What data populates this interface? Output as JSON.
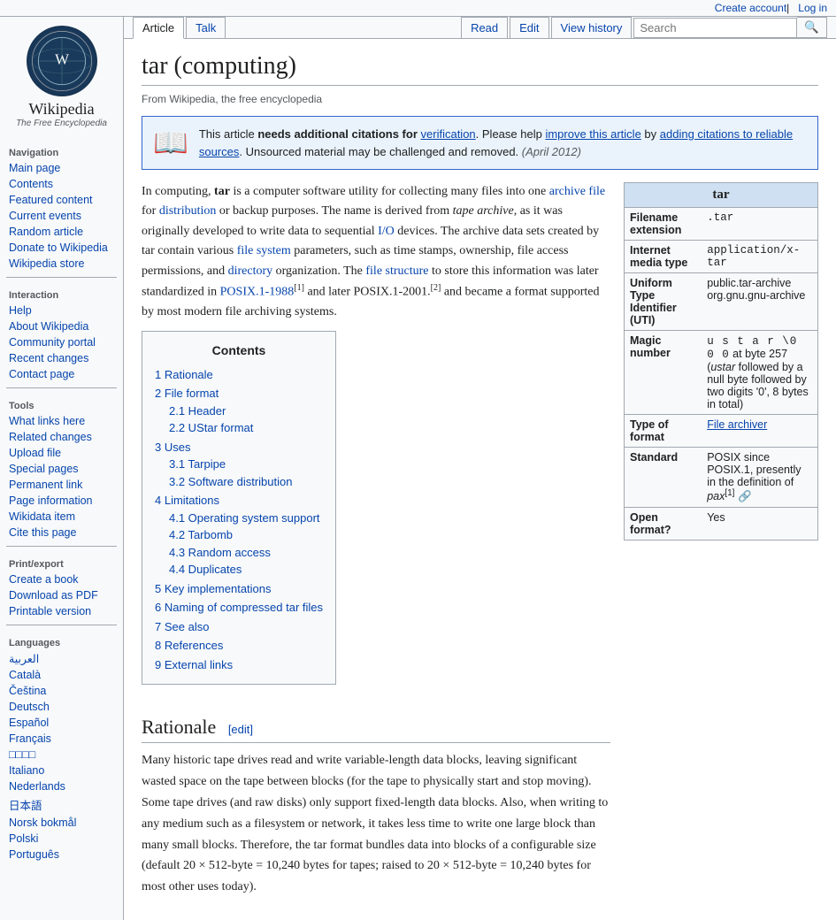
{
  "topbar": {
    "create_account": "Create account",
    "log_in": "Log in"
  },
  "logo": {
    "title": "Wikipedia",
    "subtitle": "The Free Encyclopedia"
  },
  "sidebar": {
    "navigation_label": "Navigation",
    "navigation_items": [
      {
        "label": "Main page",
        "key": "main-page"
      },
      {
        "label": "Contents",
        "key": "contents"
      },
      {
        "label": "Featured content",
        "key": "featured-content"
      },
      {
        "label": "Current events",
        "key": "current-events"
      },
      {
        "label": "Random article",
        "key": "random-article"
      },
      {
        "label": "Donate to Wikipedia",
        "key": "donate"
      },
      {
        "label": "Wikipedia store",
        "key": "store"
      }
    ],
    "interaction_label": "Interaction",
    "interaction_items": [
      {
        "label": "Help",
        "key": "help"
      },
      {
        "label": "About Wikipedia",
        "key": "about"
      },
      {
        "label": "Community portal",
        "key": "community-portal"
      },
      {
        "label": "Recent changes",
        "key": "recent-changes"
      },
      {
        "label": "Contact page",
        "key": "contact"
      }
    ],
    "tools_label": "Tools",
    "tools_items": [
      {
        "label": "What links here",
        "key": "what-links"
      },
      {
        "label": "Related changes",
        "key": "related-changes"
      },
      {
        "label": "Upload file",
        "key": "upload"
      },
      {
        "label": "Special pages",
        "key": "special"
      },
      {
        "label": "Permanent link",
        "key": "permanent"
      },
      {
        "label": "Page information",
        "key": "page-info"
      },
      {
        "label": "Wikidata item",
        "key": "wikidata"
      },
      {
        "label": "Cite this page",
        "key": "cite"
      }
    ],
    "print_label": "Print/export",
    "print_items": [
      {
        "label": "Create a book",
        "key": "create-book"
      },
      {
        "label": "Download as PDF",
        "key": "pdf"
      },
      {
        "label": "Printable version",
        "key": "printable"
      }
    ],
    "languages_label": "Languages",
    "language_items": [
      {
        "label": "العربية",
        "key": "arabic"
      },
      {
        "label": "Català",
        "key": "catala"
      },
      {
        "label": "Čeština",
        "key": "cestina"
      },
      {
        "label": "Deutsch",
        "key": "deutsch"
      },
      {
        "label": "Español",
        "key": "espanol"
      },
      {
        "label": "Français",
        "key": "francais"
      },
      {
        "label": "□□□□",
        "key": "lang4"
      },
      {
        "label": "Italiano",
        "key": "italiano"
      },
      {
        "label": "Nederlands",
        "key": "nederlands"
      },
      {
        "label": "日本語",
        "key": "japanese"
      },
      {
        "label": "Norsk bokmål",
        "key": "norsk"
      },
      {
        "label": "Polski",
        "key": "polski"
      },
      {
        "label": "Português",
        "key": "portugues"
      }
    ]
  },
  "tabs": {
    "article": "Article",
    "talk": "Talk",
    "read": "Read",
    "edit": "Edit",
    "view_history": "View history"
  },
  "search": {
    "placeholder": "Search",
    "value": ""
  },
  "page": {
    "title": "tar (computing)",
    "from_wiki": "From Wikipedia, the free encyclopedia"
  },
  "notice": {
    "icon": "📖",
    "text_before_bold": "This article ",
    "bold": "needs additional citations for",
    "link_verify": "verification",
    "text_after": ". Please help",
    "link_improve": "improve this article",
    "text_middle": "by",
    "link_adding": "adding citations to reliable sources",
    "text_end": ". Unsourced material may be challenged and removed.",
    "date": "(April 2012)"
  },
  "infobox": {
    "title": "tar",
    "rows": [
      {
        "label": "Filename extension",
        "value": ".tar",
        "mono": true
      },
      {
        "label": "Internet media type",
        "value": "application/x-tar",
        "mono": true
      },
      {
        "label": "Uniform Type Identifier (UTI)",
        "value": "public.tar-archive org.gnu.gnu-archive",
        "mono": false
      },
      {
        "label": "Magic number",
        "value": "u s t a r \\0 0 0 at byte 257 (ustar followed by a null byte followed by two digits '0', 8 bytes in total)",
        "mono": false
      },
      {
        "label": "Type of format",
        "value": "File archiver",
        "link": true,
        "mono": false
      },
      {
        "label": "Standard",
        "value": "POSIX since POSIX.1, presently in the definition of pax[1]",
        "mono": false
      },
      {
        "label": "Open format?",
        "value": "Yes",
        "mono": false
      }
    ]
  },
  "intro_text": "In computing, tar is a computer software utility for collecting many files into one archive file for distribution or backup purposes. The name is derived from tape archive, as it was originally developed to write data to sequential I/O devices. The archive data sets created by tar contain various file system parameters, such as time stamps, ownership, file access permissions, and directory organization. The file structure to store this information was later standardized in POSIX.1-1988[1] and later POSIX.1-2001.[2] and became a format supported by most modern file archiving systems.",
  "toc": {
    "title": "Contents",
    "items": [
      {
        "num": "1",
        "label": "Rationale",
        "anchor": "Rationale"
      },
      {
        "num": "2",
        "label": "File format",
        "anchor": "File_format",
        "children": [
          {
            "num": "2.1",
            "label": "Header",
            "anchor": "Header"
          },
          {
            "num": "2.2",
            "label": "UStar format",
            "anchor": "UStar_format"
          }
        ]
      },
      {
        "num": "3",
        "label": "Uses",
        "anchor": "Uses",
        "children": [
          {
            "num": "3.1",
            "label": "Tarpipe",
            "anchor": "Tarpipe"
          },
          {
            "num": "3.2",
            "label": "Software distribution",
            "anchor": "Software_distribution"
          }
        ]
      },
      {
        "num": "4",
        "label": "Limitations",
        "anchor": "Limitations",
        "children": [
          {
            "num": "4.1",
            "label": "Operating system support",
            "anchor": "OS_support"
          },
          {
            "num": "4.2",
            "label": "Tarbomb",
            "anchor": "Tarbomb"
          },
          {
            "num": "4.3",
            "label": "Random access",
            "anchor": "Random_access"
          },
          {
            "num": "4.4",
            "label": "Duplicates",
            "anchor": "Duplicates"
          }
        ]
      },
      {
        "num": "5",
        "label": "Key implementations",
        "anchor": "Key_implementations"
      },
      {
        "num": "6",
        "label": "Naming of compressed tar files",
        "anchor": "Naming"
      },
      {
        "num": "7",
        "label": "See also",
        "anchor": "See_also"
      },
      {
        "num": "8",
        "label": "References",
        "anchor": "References"
      },
      {
        "num": "9",
        "label": "External links",
        "anchor": "External_links"
      }
    ]
  },
  "rationale": {
    "heading": "Rationale",
    "edit_label": "[edit]",
    "text": "Many historic tape drives read and write variable-length data blocks, leaving significant wasted space on the tape between blocks (for the tape to physically start and stop moving). Some tape drives (and raw disks) only support fixed-length data blocks. Also, when writing to any medium such as a filesystem or network, it takes less time to write one large block than many small blocks. Therefore, the tar format bundles data into blocks of a configurable size (default 20 × 512-byte = 10,240 bytes for tapes; raised to 20 × 512-byte = 10,240 bytes for most other uses today)."
  }
}
